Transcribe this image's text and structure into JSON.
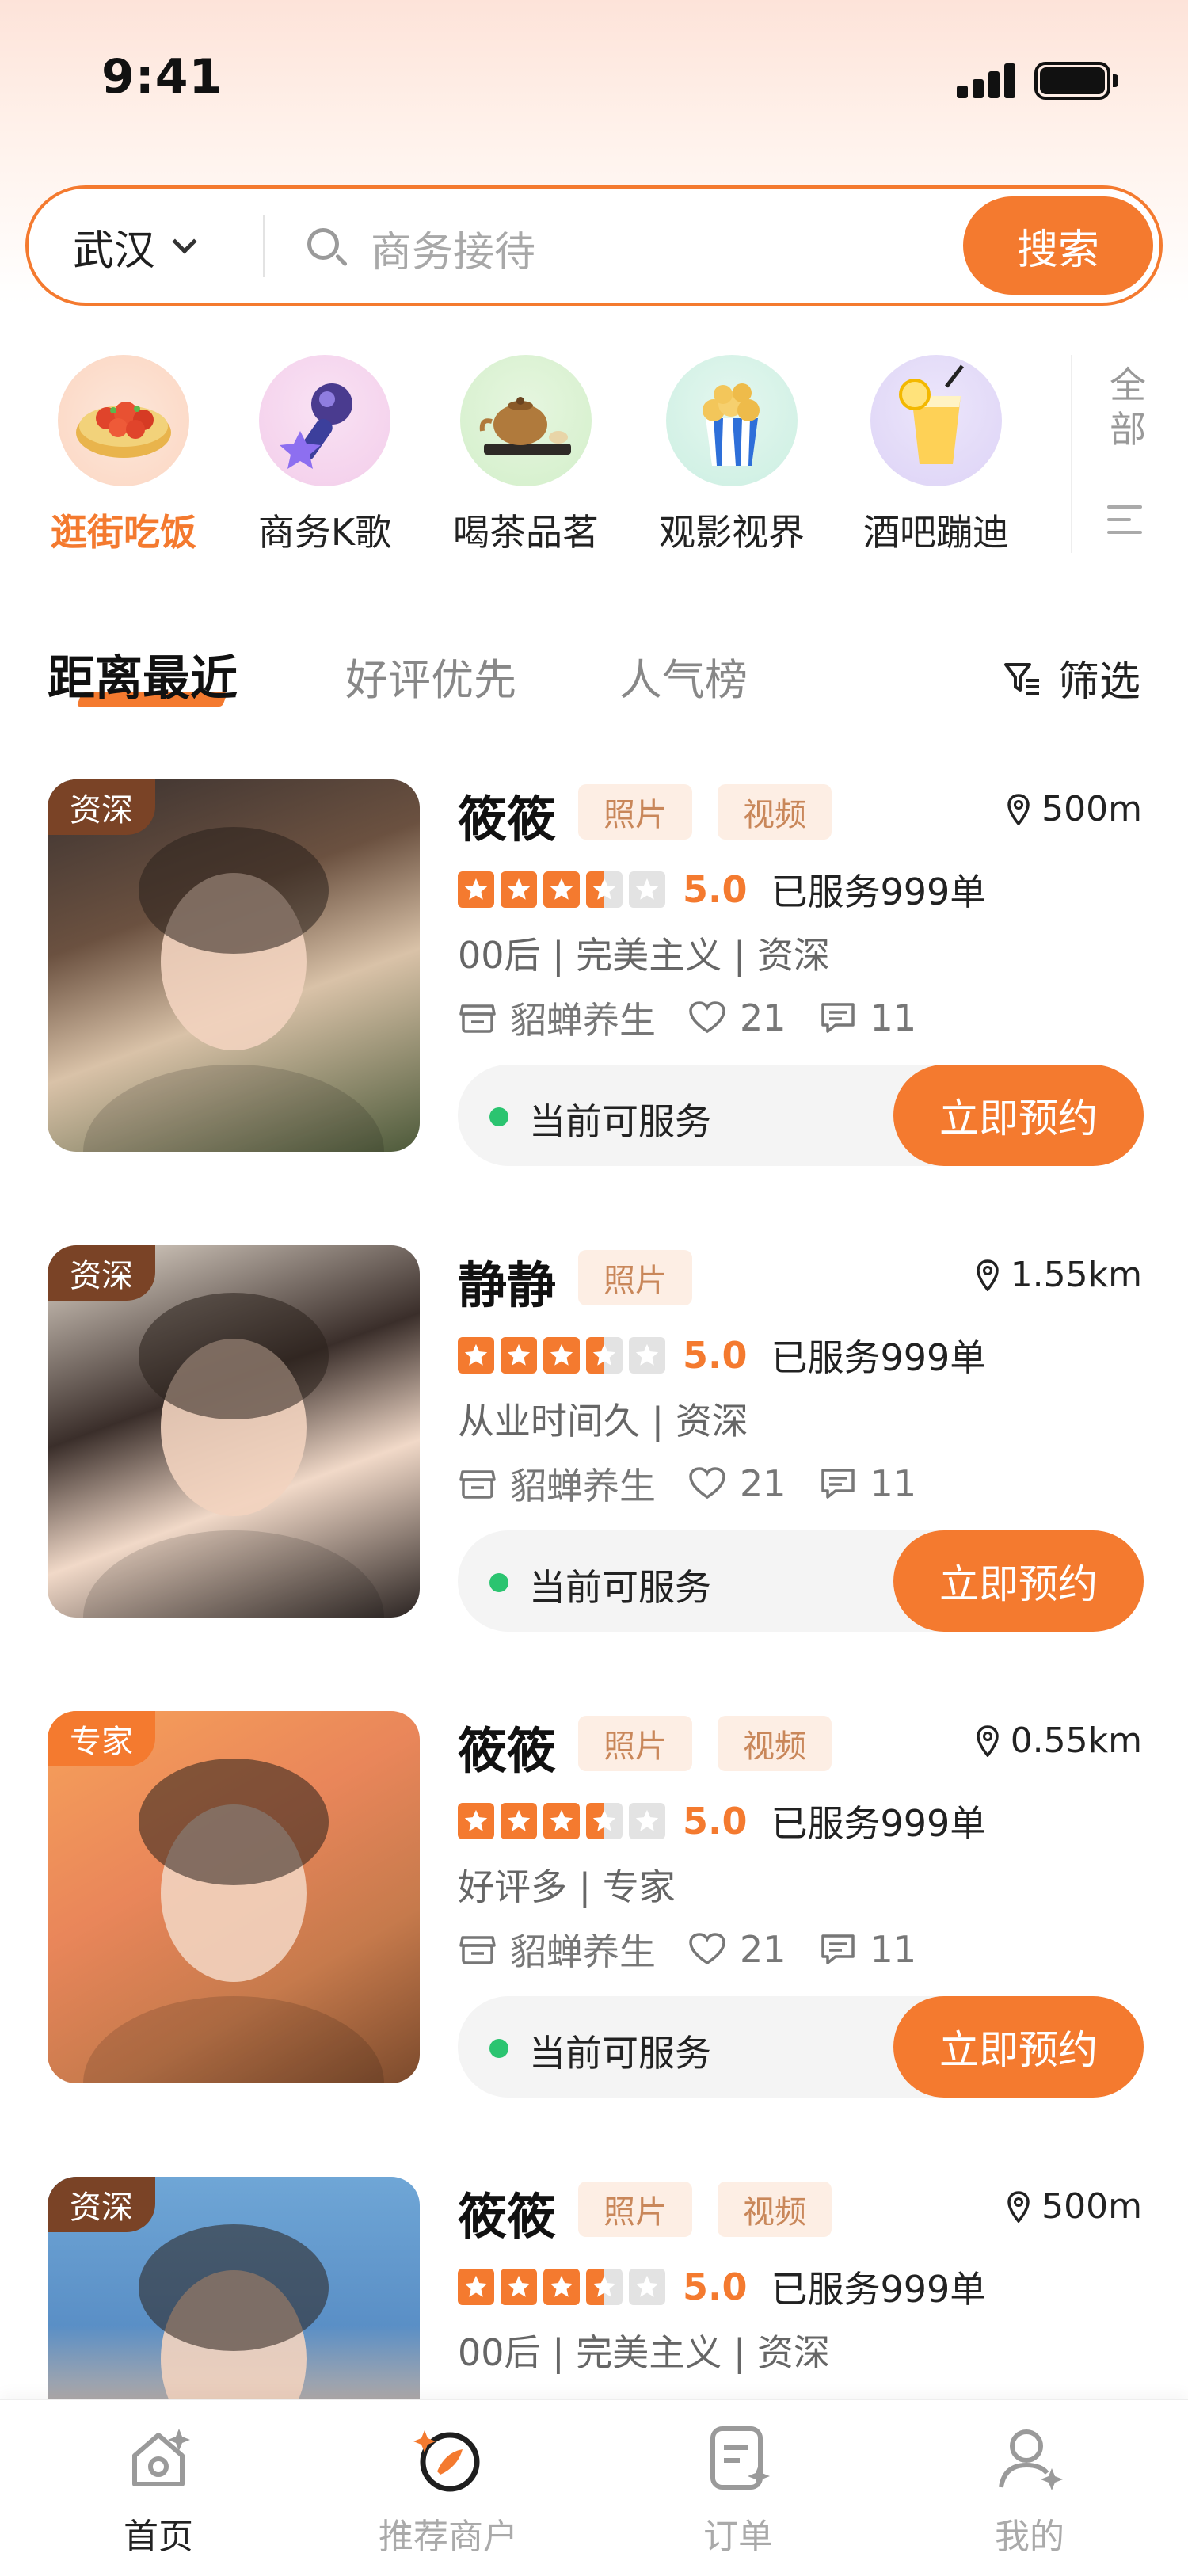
{
  "status": {
    "time": "9:41"
  },
  "search": {
    "city": "武汉",
    "placeholder": "商务接待",
    "button": "搜索"
  },
  "categories": [
    {
      "label": "逛街吃饭",
      "icon": "crawfish-icon",
      "active": true
    },
    {
      "label": "商务K歌",
      "icon": "microphone-icon",
      "active": false
    },
    {
      "label": "喝茶品茗",
      "icon": "teapot-icon",
      "active": false
    },
    {
      "label": "观影视界",
      "icon": "popcorn-icon",
      "active": false
    },
    {
      "label": "酒吧蹦迪",
      "icon": "cocktail-icon",
      "active": false
    }
  ],
  "categories_all": "全部",
  "tabs": [
    {
      "label": "距离最近",
      "active": true
    },
    {
      "label": "好评优先",
      "active": false
    },
    {
      "label": "人气榜",
      "active": false
    }
  ],
  "filter_label": "筛选",
  "listings": [
    {
      "tag": "资深",
      "tag_type": "senior",
      "name": "筱筱",
      "chips": [
        "照片",
        "视频"
      ],
      "distance": "500m",
      "rating": "5.0",
      "stars": 3.5,
      "served": "已服务999单",
      "traits": "00后 | 完美主义 | 资深",
      "shop": "貂蝉养生",
      "likes": "21",
      "comments": "11",
      "availability": "当前可服务",
      "book": "立即预约"
    },
    {
      "tag": "资深",
      "tag_type": "senior",
      "name": "静静",
      "chips": [
        "照片"
      ],
      "distance": "1.55km",
      "rating": "5.0",
      "stars": 3.5,
      "served": "已服务999单",
      "traits": "从业时间久 | 资深",
      "shop": "貂蝉养生",
      "likes": "21",
      "comments": "11",
      "availability": "当前可服务",
      "book": "立即预约"
    },
    {
      "tag": "专家",
      "tag_type": "expert",
      "name": "筱筱",
      "chips": [
        "照片",
        "视频"
      ],
      "distance": "0.55km",
      "rating": "5.0",
      "stars": 3.5,
      "served": "已服务999单",
      "traits": "好评多 | 专家",
      "shop": "貂蝉养生",
      "likes": "21",
      "comments": "11",
      "availability": "当前可服务",
      "book": "立即预约"
    },
    {
      "tag": "资深",
      "tag_type": "senior",
      "name": "筱筱",
      "chips": [
        "照片",
        "视频"
      ],
      "distance": "500m",
      "rating": "5.0",
      "stars": 3.5,
      "served": "已服务999单",
      "traits": "00后 | 完美主义 | 资深"
    }
  ],
  "nav": [
    {
      "label": "首页",
      "icon": "home-icon",
      "active": true
    },
    {
      "label": "推荐商户",
      "icon": "recommend-icon",
      "active": false
    },
    {
      "label": "订单",
      "icon": "order-icon",
      "active": false
    },
    {
      "label": "我的",
      "icon": "profile-icon",
      "active": false
    }
  ],
  "colors": {
    "accent": "#f47a2f",
    "available": "#2bc470",
    "senior_tag": "#7a4326"
  }
}
